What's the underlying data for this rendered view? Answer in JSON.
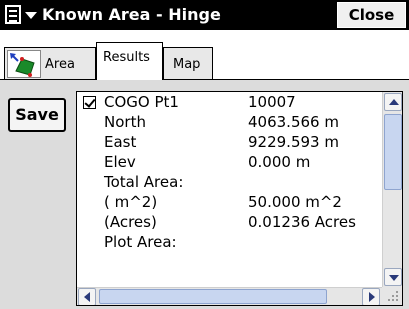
{
  "window": {
    "title": "Known Area - Hinge",
    "close_label": "Close"
  },
  "tabs": [
    {
      "label": "Area",
      "icon": "area-polygon-icon"
    },
    {
      "label": "Results",
      "selected": true
    },
    {
      "label": "Map"
    }
  ],
  "toolbar": {
    "save_label": "Save"
  },
  "results": {
    "rows": [
      {
        "label": "COGO Pt1",
        "value": "10007",
        "checked": true
      },
      {
        "label": "North",
        "value": "4063.566 m"
      },
      {
        "label": "East",
        "value": "9229.593 m"
      },
      {
        "label": "Elev",
        "value": "0.000 m"
      },
      {
        "label": "Total Area:",
        "value": ""
      },
      {
        "label": "( m^2)",
        "value": "50.000  m^2"
      },
      {
        "label": "(Acres)",
        "value": "0.01236 Acres"
      },
      {
        "label": "Plot Area:",
        "value": ""
      }
    ]
  },
  "colors": {
    "titlebar": "#000000",
    "panel": "#dcdcdc",
    "scroll_thumb": "#c8d6f0"
  }
}
